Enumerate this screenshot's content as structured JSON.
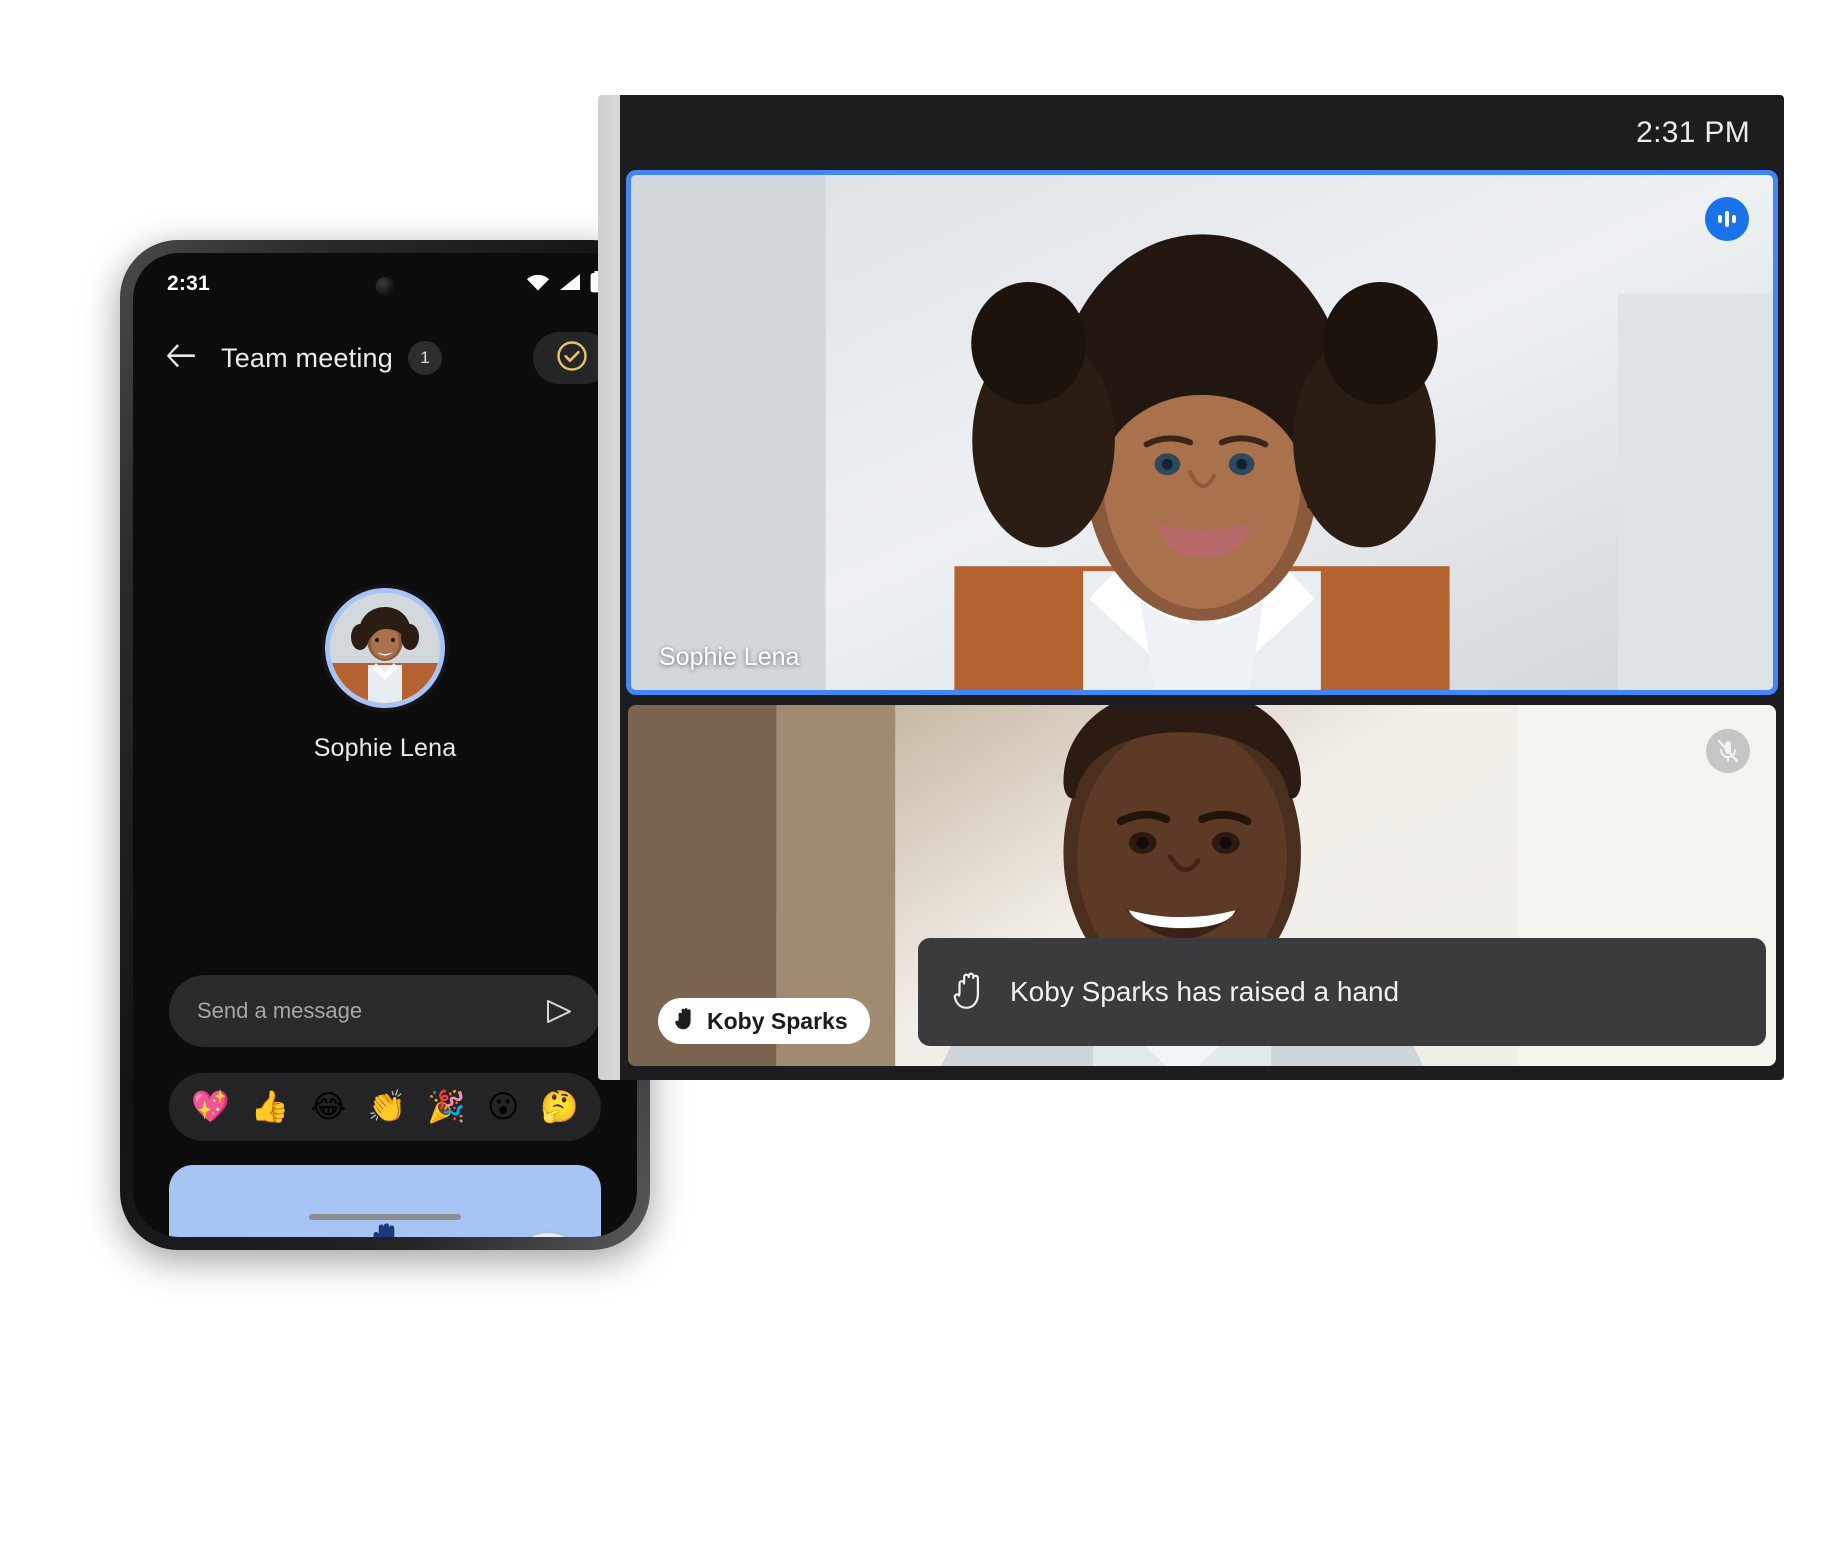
{
  "phone": {
    "status_bar": {
      "time": "2:31",
      "icons": [
        "wifi-icon",
        "cellular-signal-icon",
        "battery-icon"
      ]
    },
    "app_bar": {
      "back_icon": "arrow-back-icon",
      "title": "Team meeting",
      "participant_badge": "1",
      "action_icon": "check-circle-icon",
      "action_icon_color": "#e3c66a"
    },
    "stage": {
      "speaker_name": "Sophie Lena",
      "avatar_ring_color": "#a8c4f5"
    },
    "message_bar": {
      "placeholder": "Send a message",
      "send_icon": "send-icon"
    },
    "reactions": [
      {
        "name": "sparkling-heart-emoji",
        "glyph": "💖"
      },
      {
        "name": "thumbs-up-emoji",
        "glyph": "👍"
      },
      {
        "name": "face-with-tears-of-joy-emoji",
        "glyph": "😂"
      },
      {
        "name": "clapping-hands-emoji",
        "glyph": "👏"
      },
      {
        "name": "party-popper-emoji",
        "glyph": "🎉"
      },
      {
        "name": "face-with-open-mouth-emoji",
        "glyph": "😮"
      },
      {
        "name": "thinking-face-emoji",
        "glyph": "🤔"
      }
    ],
    "raise_hand_panel": {
      "icon": "raised-hand-icon",
      "panel_color": "#a8c4f5",
      "icon_color": "#1a3a7a",
      "thumb_color": "#eceff1"
    },
    "controls": [
      {
        "name": "end-call-button",
        "icon": "call-end-icon",
        "color": "#e03127"
      },
      {
        "name": "closed-captions-button",
        "icon": "cc-icon",
        "color": "#2c2c2e"
      },
      {
        "name": "more-options-button",
        "icon": "more-vert-icon",
        "color": "#2c2c2e"
      }
    ]
  },
  "tablet": {
    "top_bar": {
      "time": "2:31 PM"
    },
    "tiles": [
      {
        "name": "Sophie Lena",
        "state": "speaking",
        "badge_icon": "audio-level-icon",
        "border_color": "#4285f4",
        "active": true
      },
      {
        "name": "Koby Sparks",
        "state": "muted",
        "badge_icon": "mic-off-icon",
        "label_icon": "raised-hand-icon",
        "active": false
      }
    ],
    "toast": {
      "icon": "raised-hand-icon",
      "text": "Koby Sparks has raised a hand"
    }
  }
}
